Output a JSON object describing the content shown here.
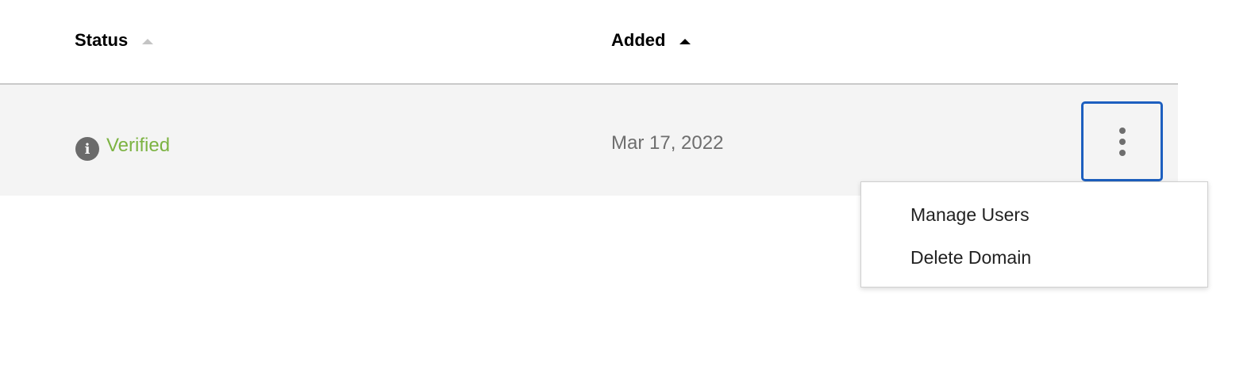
{
  "table": {
    "columns": [
      {
        "label": "Status",
        "sort": "inactive"
      },
      {
        "label": "Added",
        "sort": "ascending"
      }
    ],
    "rows": [
      {
        "status": "Verified",
        "status_icon": "info-icon",
        "added": "Mar 17, 2022",
        "actions_icon": "kebab-icon"
      }
    ]
  },
  "menu": {
    "items": [
      {
        "label": "Manage Users"
      },
      {
        "label": "Delete Domain"
      }
    ]
  },
  "colors": {
    "verified": "#7cb342",
    "focus_border": "#1d5fbf",
    "row_background": "#f4f4f4"
  }
}
